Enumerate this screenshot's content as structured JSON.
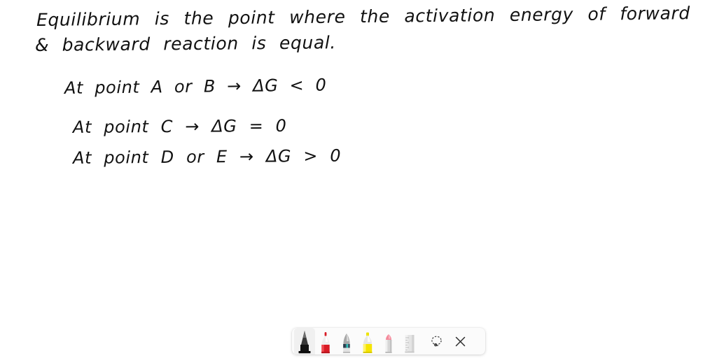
{
  "document": {
    "background_color": "#ffffff",
    "ink_color": "#111111",
    "handwriting": {
      "line_1": "Equilibrium is  the   point  where  the  activation  energy  of  forward",
      "line_2": "& backward  reaction  is  equal.",
      "line_3": "At  point  A or B →    ΔG < 0",
      "line_4": "At   point  C  →    ΔG = 0",
      "line_5": "At  point  D or E  →    ΔG > 0"
    }
  },
  "markup_toolbar": {
    "background_color": "#fbfbfb",
    "selected_tool": "black-pen",
    "tools": [
      {
        "id": "black-pen",
        "label": "Pen",
        "color": "#1a1a1a",
        "selected": true
      },
      {
        "id": "red-marker",
        "label": "Marker",
        "color": "#e01b24",
        "selected": false
      },
      {
        "id": "pencil",
        "label": "Pencil",
        "color": "#4a5a6a",
        "selected": false
      },
      {
        "id": "yellow-highlighter",
        "label": "Highlighter",
        "color": "#f5e400",
        "selected": false
      },
      {
        "id": "pink-eraser",
        "label": "Eraser",
        "color": "#f39aa6",
        "selected": false
      },
      {
        "id": "ruler",
        "label": "Ruler",
        "color": "#c9c9c9",
        "selected": false
      },
      {
        "id": "lasso-select",
        "label": "Lasso Select",
        "color": "#3c3c3c",
        "selected": false
      },
      {
        "id": "close",
        "label": "Close",
        "color": "#3c3c3c",
        "selected": false
      }
    ]
  }
}
